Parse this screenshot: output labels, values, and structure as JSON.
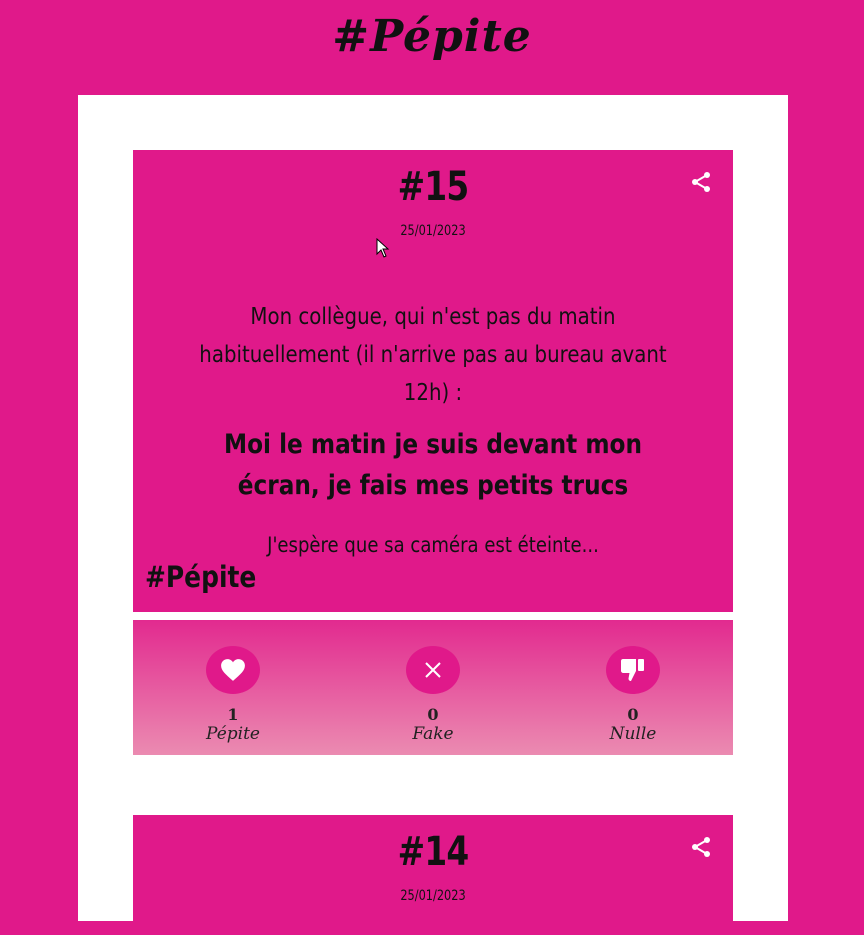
{
  "site": {
    "title": "#Pépite"
  },
  "posts": [
    {
      "number": "#15",
      "date": "25/01/2023",
      "intro": "Mon collègue, qui n'est pas du matin habituellement (il n'arrive pas au bureau avant 12h) :",
      "quote": "Moi le matin je suis devant mon écran, je fais mes petits trucs",
      "outro": "J'espère que sa caméra est éteinte...",
      "tag": "#Pépite",
      "share_icon": "share-icon",
      "reactions": [
        {
          "icon": "heart-icon",
          "count": "1",
          "label": "Pépite"
        },
        {
          "icon": "close-icon",
          "count": "0",
          "label": "Fake"
        },
        {
          "icon": "thumbs-down-icon",
          "count": "0",
          "label": "Nulle"
        }
      ]
    },
    {
      "number": "#14",
      "date": "25/01/2023",
      "share_icon": "share-icon"
    }
  ],
  "colors": {
    "brand": "#e0198a",
    "card_bg": "#e0198a",
    "page_bg": "#ffffff",
    "text": "#111111"
  }
}
